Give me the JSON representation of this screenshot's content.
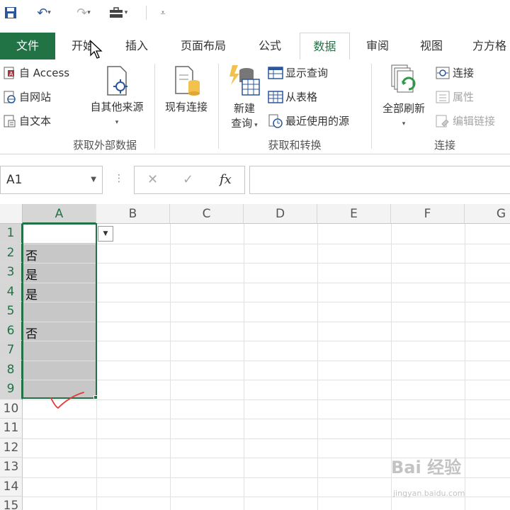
{
  "tabs": {
    "file": "文件",
    "home": "开始",
    "insert": "插入",
    "page_layout": "页面布局",
    "formulas": "公式",
    "data": "数据",
    "review": "审阅",
    "view": "视图",
    "addin": "方方格"
  },
  "ribbon": {
    "get_external": {
      "access": "自 Access",
      "web": "自网站",
      "text": "自文本",
      "other": "自其他来源",
      "label": "获取外部数据"
    },
    "existing": "现有连接",
    "transform": {
      "new_query_1": "新建",
      "new_query_2": "查询",
      "show_queries": "显示查询",
      "from_table": "从表格",
      "recent_sources": "最近使用的源",
      "label": "获取和转换"
    },
    "connections": {
      "refresh_all": "全部刷新",
      "connections": "连接",
      "properties": "属性",
      "edit_links": "编辑链接",
      "label": "连接"
    }
  },
  "formula_bar": {
    "name_box": "A1",
    "cancel": "✕",
    "enter": "✓",
    "fx": "fx",
    "value": ""
  },
  "grid": {
    "columns": [
      "A",
      "B",
      "C",
      "D",
      "E",
      "F",
      "G"
    ],
    "rows": [
      "1",
      "2",
      "3",
      "4",
      "5",
      "6",
      "7",
      "8",
      "9",
      "10",
      "11",
      "12",
      "13",
      "14",
      "15"
    ],
    "column_a": [
      "",
      "否",
      "是",
      "是",
      "",
      "否",
      "",
      "",
      ""
    ]
  },
  "watermark": {
    "text": "Bai 经验",
    "sub": "jingyan.baidu.com"
  },
  "colors": {
    "accent": "#217346",
    "selection_fill": "#c7c7c7",
    "annotation": "#e53935"
  }
}
